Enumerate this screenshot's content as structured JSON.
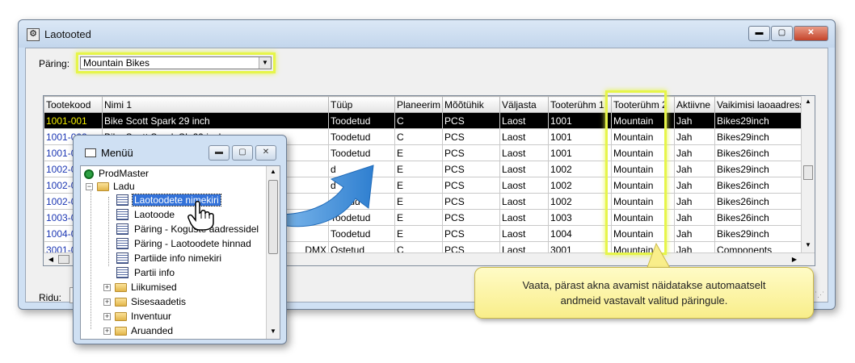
{
  "main_window": {
    "title": "Laotooted",
    "controls": {
      "minimize": "▬",
      "maximize": "▢",
      "close": "✕"
    }
  },
  "query": {
    "label": "Päring:",
    "selected": "Mountain Bikes"
  },
  "grid": {
    "columns": [
      "Tootekood",
      "Nimi 1",
      "Tüüp",
      "Planeerim",
      "Mõõtühik",
      "Väljasta",
      "Tooterühm 1",
      "Tooterühm 2",
      "Aktiivne",
      "Vaikimisi laoaadress"
    ],
    "rows": [
      [
        "1001-001",
        "Bike Scott Spark 29 inch",
        "Toodetud",
        "C",
        "PCS",
        "Laost",
        "1001",
        "Mountain",
        "Jah",
        "Bikes29inch"
      ],
      [
        "1001-002",
        "Bike Scott Spark SL 29 inch",
        "Toodetud",
        "C",
        "PCS",
        "Laost",
        "1001",
        "Mountain",
        "Jah",
        "Bikes29inch"
      ],
      [
        "1001-0",
        "",
        "Toodetud",
        "E",
        "PCS",
        "Laost",
        "1001",
        "Mountain",
        "Jah",
        "Bikes26inch"
      ],
      [
        "1002-0",
        "",
        "d",
        "E",
        "PCS",
        "Laost",
        "1002",
        "Mountain",
        "Jah",
        "Bikes29inch"
      ],
      [
        "1002-0",
        "",
        "d",
        "E",
        "PCS",
        "Laost",
        "1002",
        "Mountain",
        "Jah",
        "Bikes26inch"
      ],
      [
        "1002-0",
        "",
        "odetud",
        "E",
        "PCS",
        "Laost",
        "1002",
        "Mountain",
        "Jah",
        "Bikes26inch"
      ],
      [
        "1003-0",
        "",
        "Toodetud",
        "E",
        "PCS",
        "Laost",
        "1003",
        "Mountain",
        "Jah",
        "Bikes26inch"
      ],
      [
        "1004-0",
        "",
        "Toodetud",
        "E",
        "PCS",
        "Laost",
        "1004",
        "Mountain",
        "Jah",
        "Bikes29inch"
      ],
      [
        "3001-0",
        "DMX",
        "Ostetud",
        "C",
        "PCS",
        "Laost",
        "3001",
        "Mountain",
        "Jah",
        "Components"
      ]
    ],
    "rows_label": "Ridu:"
  },
  "menu_window": {
    "title": "Menüü",
    "controls": {
      "minimize": "▬",
      "maximize": "▢",
      "close": "✕"
    },
    "tree": [
      {
        "label": "ProdMaster"
      },
      {
        "label": "Ladu"
      },
      {
        "label": "Laotoodete nimekiri"
      },
      {
        "label": "Laotoode"
      },
      {
        "label": "Päring - Koguste aadressidel"
      },
      {
        "label": "Päring - Laotoodete hinnad"
      },
      {
        "label": "Partiide info nimekiri"
      },
      {
        "label": "Partii info"
      },
      {
        "label": "Liikumised"
      },
      {
        "label": "Sisesaadetis"
      },
      {
        "label": "Inventuur"
      },
      {
        "label": "Aruanded"
      }
    ]
  },
  "callout": {
    "line1": "Vaata, pärast akna avamist näidatakse automaatselt",
    "line2": "andmeid vastavalt valitud päringule."
  },
  "colors": {
    "highlight": "#e6f54a",
    "selection": "#000000",
    "code_link": "#1b36b3",
    "arrow": "#2f7fd0"
  }
}
